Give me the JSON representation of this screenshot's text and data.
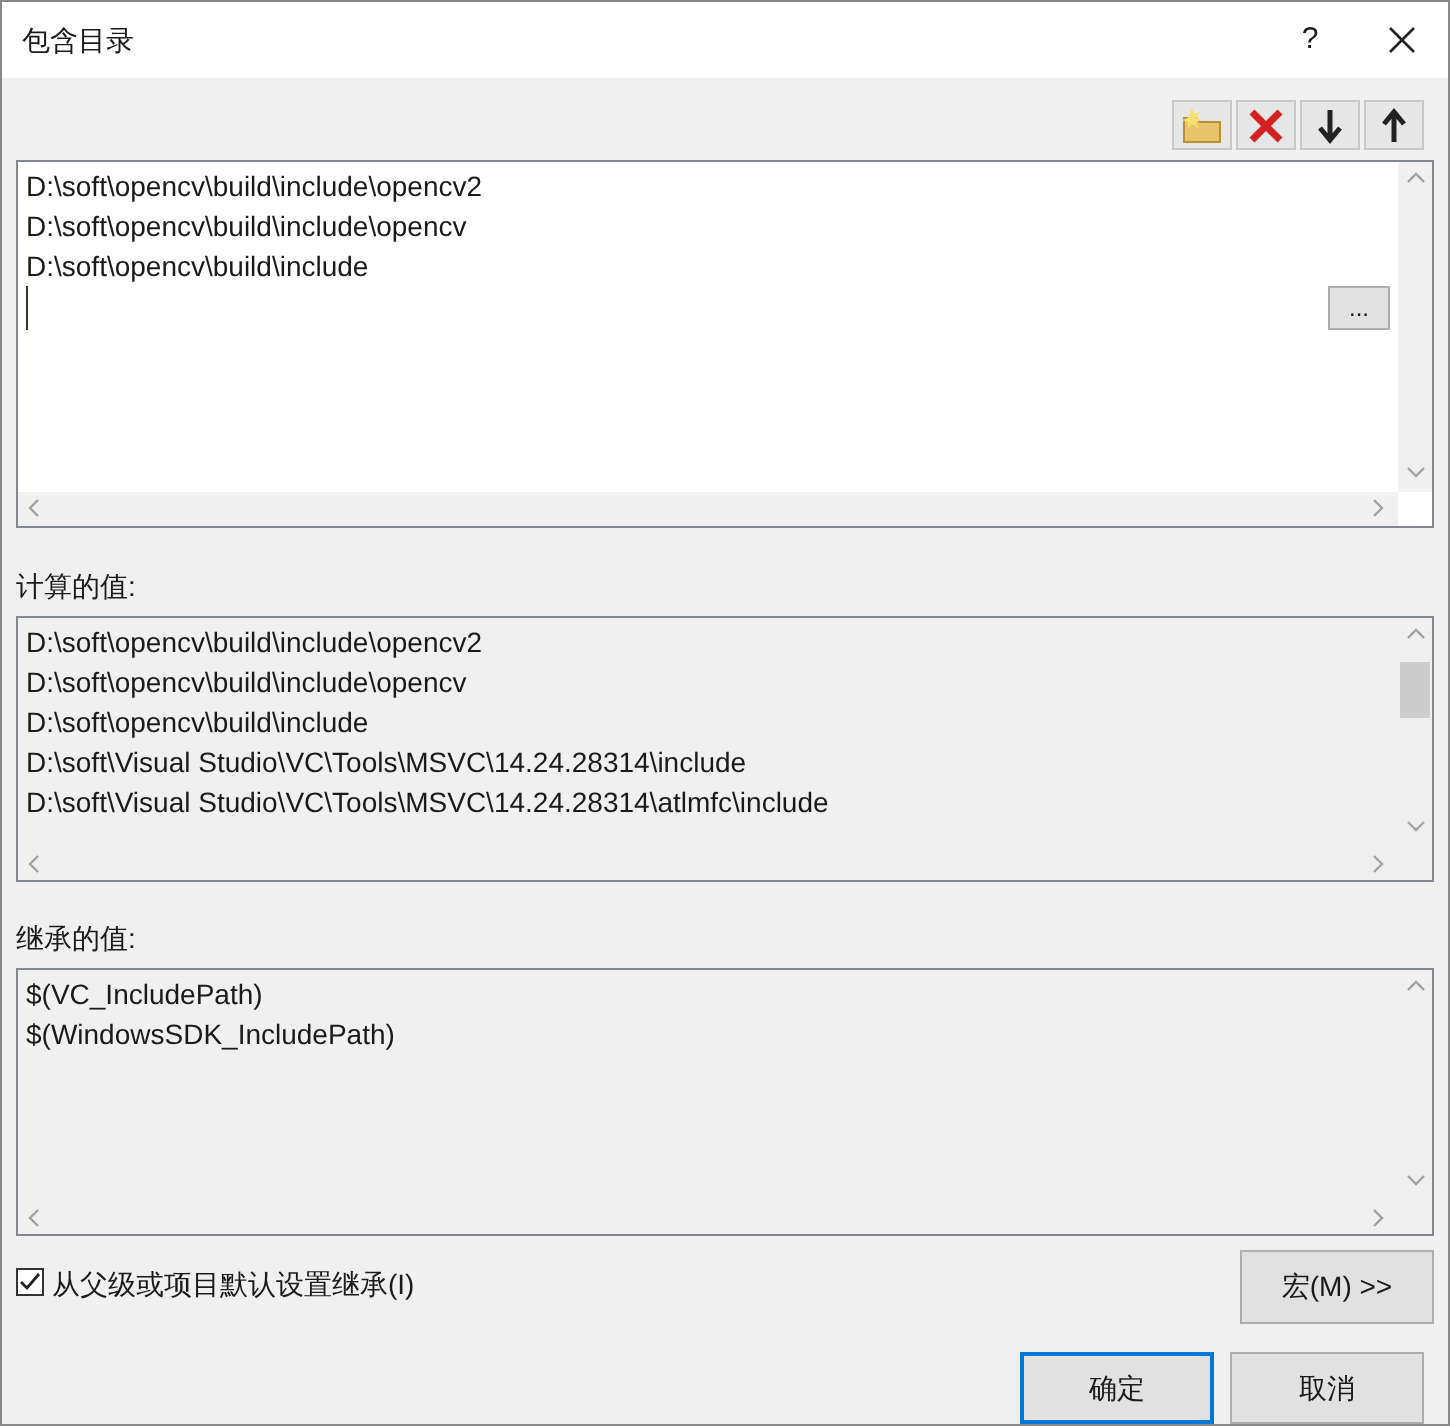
{
  "window": {
    "title": "包含目录",
    "help": "?"
  },
  "toolbar": {
    "buttons": [
      {
        "kind": "new-folder"
      },
      {
        "kind": "delete"
      },
      {
        "kind": "move-down"
      },
      {
        "kind": "move-up"
      }
    ]
  },
  "entries": {
    "lines": [
      "D:\\soft\\opencv\\build\\include\\opencv2",
      "D:\\soft\\opencv\\build\\include\\opencv",
      "D:\\soft\\opencv\\build\\include"
    ],
    "browse_button": "..."
  },
  "computed": {
    "label": "计算的值:",
    "lines": [
      "D:\\soft\\opencv\\build\\include\\opencv2",
      "D:\\soft\\opencv\\build\\include\\opencv",
      "D:\\soft\\opencv\\build\\include",
      "D:\\soft\\Visual Studio\\VC\\Tools\\MSVC\\14.24.28314\\include",
      "D:\\soft\\Visual Studio\\VC\\Tools\\MSVC\\14.24.28314\\atlmfc\\include"
    ]
  },
  "inherited": {
    "label": "继承的值:",
    "lines": [
      "$(VC_IncludePath)",
      "$(WindowsSDK_IncludePath)"
    ]
  },
  "inherit_checkbox": {
    "label": "从父级或项目默认设置继承(I)",
    "checked": true
  },
  "macro_button": "宏(M) >>",
  "buttons": [
    {
      "label": "确定",
      "selected": true
    },
    {
      "label": "取消",
      "selected": false
    }
  ]
}
